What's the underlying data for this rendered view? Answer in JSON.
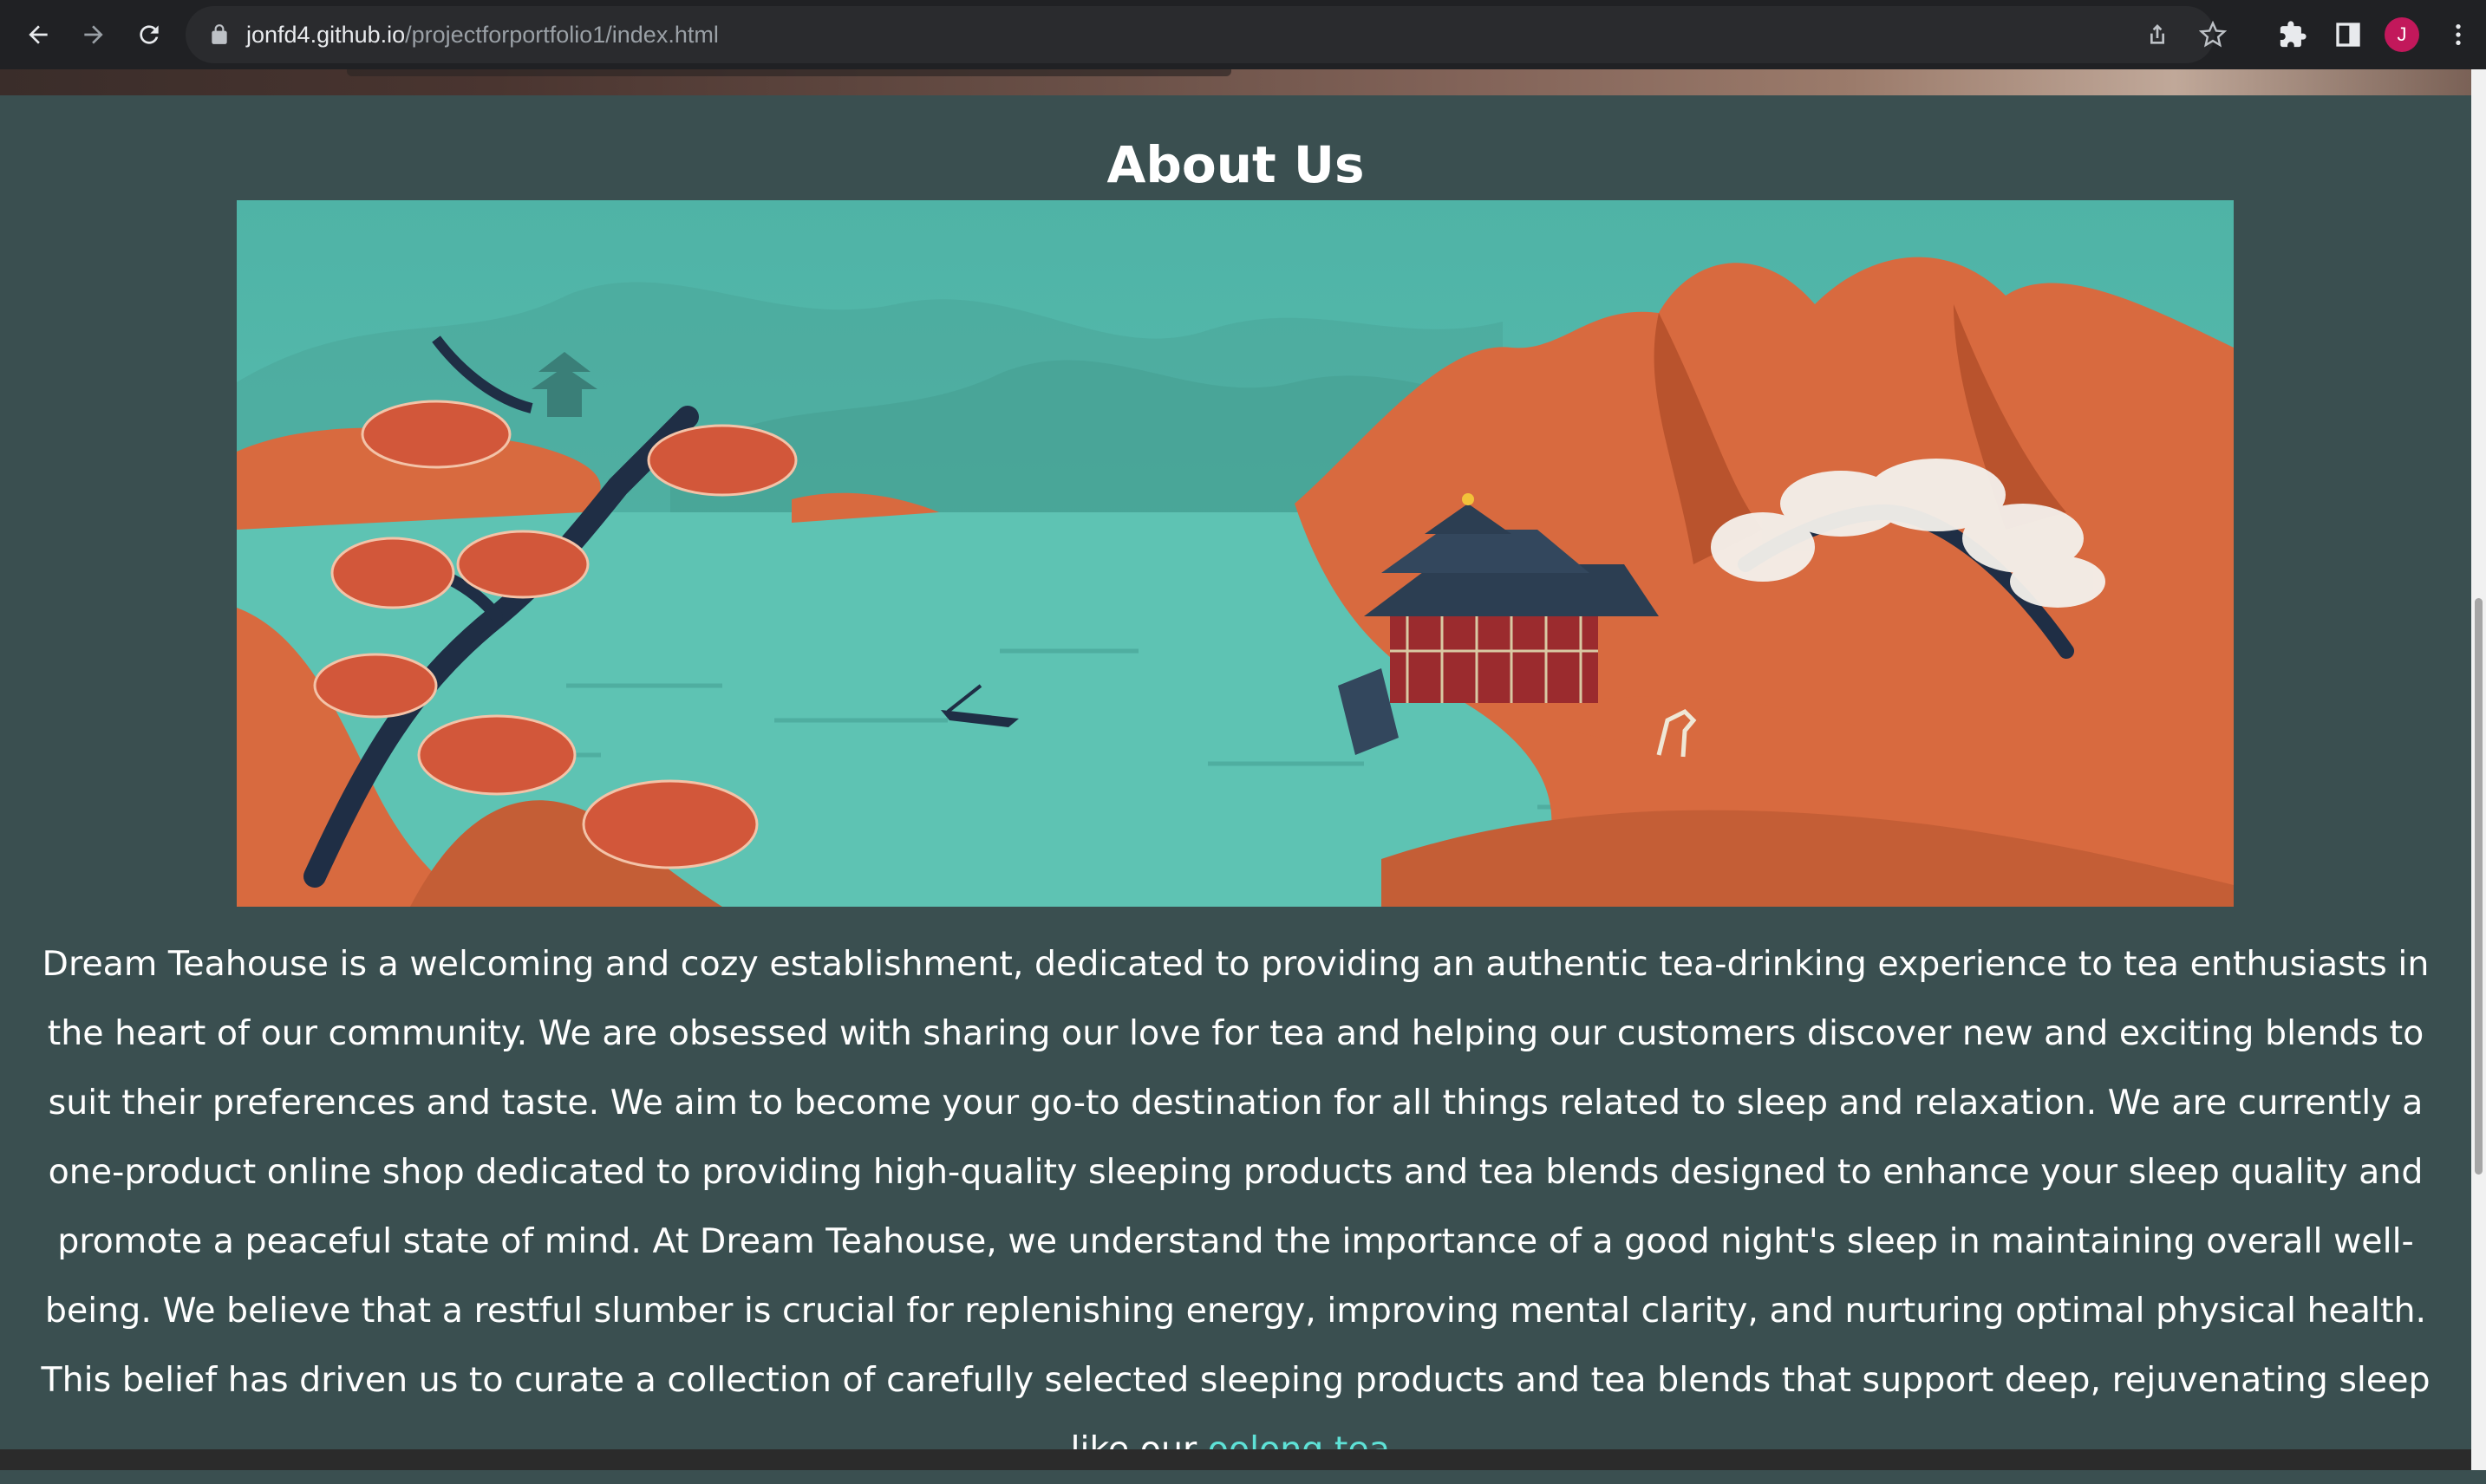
{
  "browser": {
    "url_host": "jonfd4.github.io",
    "url_path": "/projectforportfolio1/index.html",
    "profile_initial": "J"
  },
  "page": {
    "heading": "About Us",
    "paragraph": "Dream Teahouse is a welcoming and cozy establishment, dedicated to providing an authentic tea-drinking experience to tea enthusiasts in the heart of our community. We are obsessed with sharing our love for tea and helping our customers discover new and exciting blends to suit their preferences and taste. We aim to become your go-to destination for all things related to sleep and relaxation. We are currently a one-product online shop dedicated to providing high-quality sleeping products and tea blends designed to enhance your sleep quality and promote a peaceful state of mind. At Dream Teahouse, we understand the importance of a good night's sleep in maintaining overall well-being. We believe that a restful slumber is crucial for replenishing energy, improving mental clarity, and nurturing optimal physical health. This belief has driven us to curate a collection of carefully selected sleeping products and tea blends that support deep, rejuvenating sleep like our",
    "link_text": "oolong tea",
    "trailing": "."
  },
  "colors": {
    "page_bg": "#3a4f50",
    "link": "#5ee2d7",
    "banner_teal": "#55b8aa",
    "banner_orange": "#d86a3f"
  }
}
